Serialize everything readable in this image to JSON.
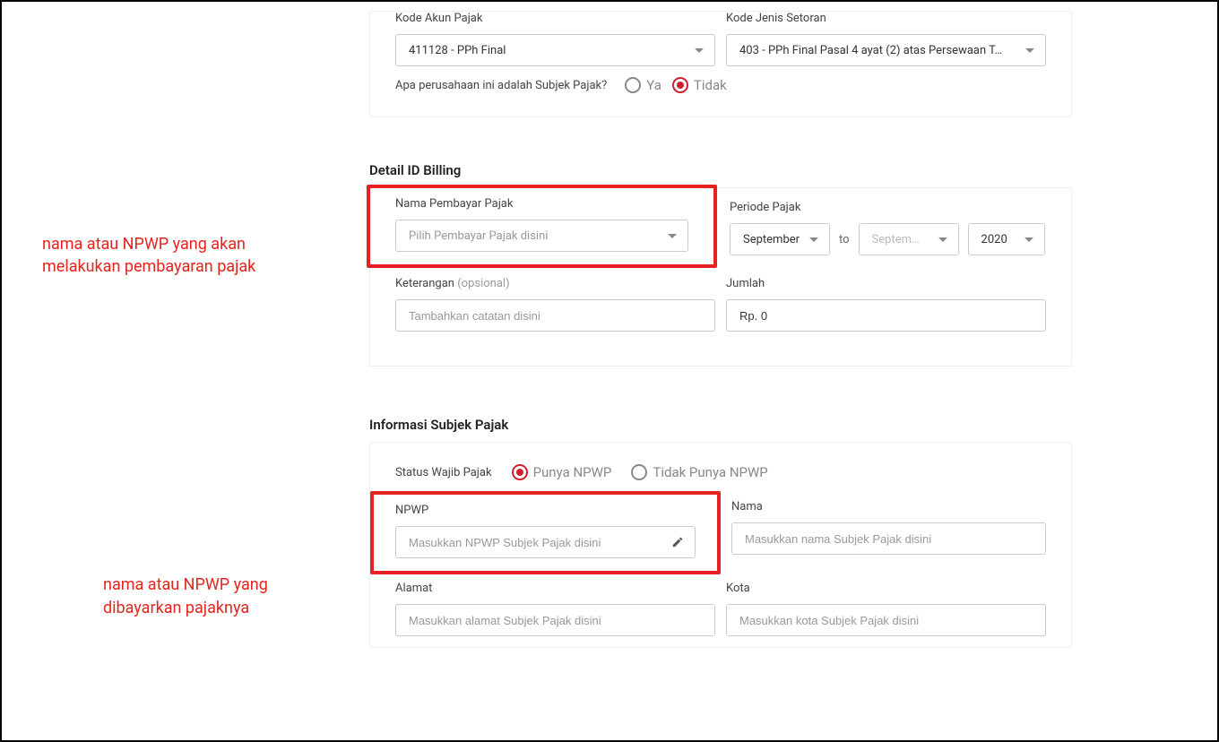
{
  "annotations": {
    "first": "nama atau NPWP yang akan\nmelakukan pembayaran pajak",
    "second": "nama atau NPWP yang\ndibayarkan pajaknya"
  },
  "topSection": {
    "kodeAkun": {
      "label": "Kode Akun Pajak",
      "value": "411128 - PPh Final"
    },
    "kodeJenis": {
      "label": "Kode Jenis Setoran",
      "value": "403 - PPh Final Pasal 4 ayat (2) atas Persewaan T…"
    },
    "subjekQuestion": "Apa perusahaan ini adalah Subjek Pajak?",
    "subjekYes": "Ya",
    "subjekNo": "Tidak"
  },
  "detailBilling": {
    "title": "Detail ID Billing",
    "namaPembayarLabel": "Nama Pembayar Pajak",
    "namaPembayarPlaceholder": "Pilih Pembayar Pajak disini",
    "periodeLabel": "Periode Pajak",
    "periodeFrom": "September",
    "periodeToWord": "to",
    "periodeTo": "Septem…",
    "periodeYear": "2020",
    "keteranganLabel": "Keterangan",
    "keteranganOptional": "(opsional)",
    "keteranganPlaceholder": "Tambahkan catatan disini",
    "jumlahLabel": "Jumlah",
    "jumlahValue": "Rp. 0"
  },
  "informasiSubjek": {
    "title": "Informasi Subjek Pajak",
    "statusLabel": "Status Wajib Pajak",
    "statusPunya": "Punya NPWP",
    "statusTidak": "Tidak Punya NPWP",
    "npwpLabel": "NPWP",
    "npwpPlaceholder": "Masukkan NPWP Subjek Pajak disini",
    "namaLabel": "Nama",
    "namaPlaceholder": "Masukkan nama Subjek Pajak disini",
    "alamatLabel": "Alamat",
    "alamatPlaceholder": "Masukkan alamat Subjek Pajak disini",
    "kotaLabel": "Kota",
    "kotaPlaceholder": "Masukkan kota Subjek Pajak disini"
  }
}
